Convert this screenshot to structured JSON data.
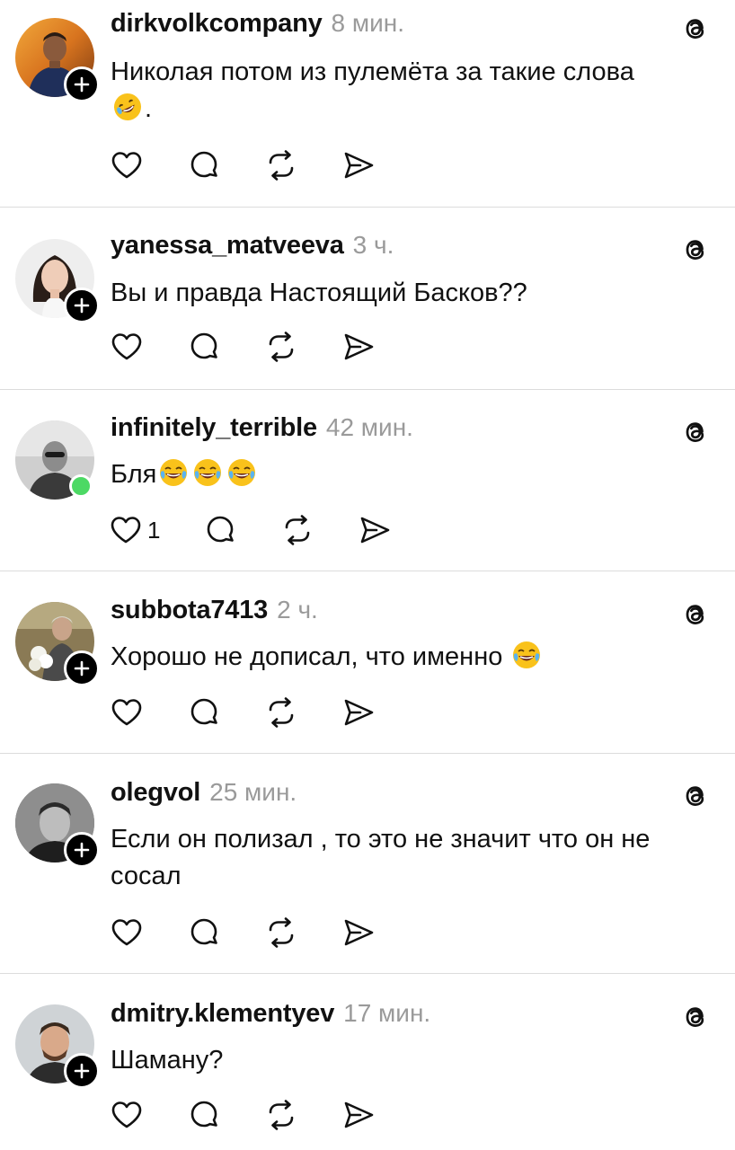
{
  "posts": [
    {
      "username": "dirkvolkcompany",
      "time": "8 мин.",
      "text": "Николая потом из пулемёта за такие слова",
      "text_suffix": ".",
      "emoji": "rofl",
      "avatar_badge": "follow",
      "like_count": null
    },
    {
      "username": "yanessa_matveeva",
      "time": "3 ч.",
      "text": "Вы и правда Настоящий Басков??",
      "avatar_badge": "follow",
      "like_count": null
    },
    {
      "username": "infinitely_terrible",
      "time": "42 мин.",
      "text": "Бля",
      "emoji": "joy",
      "emoji_count": 3,
      "avatar_badge": "online",
      "like_count": "1"
    },
    {
      "username": "subbota7413",
      "time": "2 ч.",
      "text": "Хорошо не дописал, что именно",
      "emoji": "joy",
      "avatar_badge": "follow",
      "like_count": null
    },
    {
      "username": "olegvol",
      "time": "25 мин.",
      "text": "Если он полизал , то это не значит что он не сосал",
      "avatar_badge": "follow",
      "like_count": null
    },
    {
      "username": "dmitry.klementyev",
      "time": "17 мин.",
      "text": "Шаману?",
      "avatar_badge": "follow",
      "like_count": null
    }
  ],
  "icons": {
    "like": "heart-icon",
    "reply": "comment-icon",
    "repost": "repost-icon",
    "share": "send-icon",
    "app": "threads-icon",
    "follow": "plus-icon"
  },
  "colors": {
    "text": "#111111",
    "muted": "#9a9a9a",
    "divider": "#dcdcdc",
    "online": "#4cd964"
  }
}
